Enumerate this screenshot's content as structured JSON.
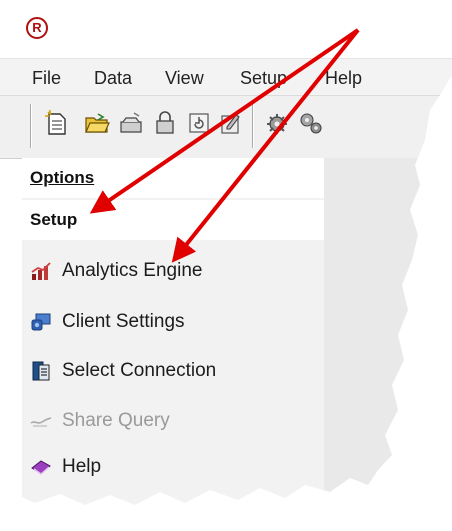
{
  "app": {
    "logo_text": "R"
  },
  "menubar": {
    "items": [
      {
        "label": "File"
      },
      {
        "label": "Data"
      },
      {
        "label": "View"
      },
      {
        "label": "Setup"
      },
      {
        "label": "Help"
      }
    ]
  },
  "toolbar": {
    "buttons": [
      {
        "icon": "new-document-icon"
      },
      {
        "icon": "open-folder-icon"
      },
      {
        "icon": "open-file-icon"
      },
      {
        "icon": "lock-icon"
      },
      {
        "icon": "refresh-icon"
      },
      {
        "icon": "edit-icon"
      },
      {
        "icon": "gear-icon"
      },
      {
        "icon": "gears-icon"
      }
    ]
  },
  "sidebar": {
    "options_label": "Options",
    "setup_label": "Setup",
    "items": [
      {
        "label": "Analytics Engine",
        "icon": "analytics-chart-icon",
        "enabled": true
      },
      {
        "label": "Client Settings",
        "icon": "client-settings-icon",
        "enabled": true
      },
      {
        "label": "Select Connection",
        "icon": "connection-icon",
        "enabled": true
      },
      {
        "label": "Share Query",
        "icon": "share-query-icon",
        "enabled": false
      },
      {
        "label": "Help",
        "icon": "help-book-icon",
        "enabled": true
      }
    ]
  },
  "annotation": {
    "arrow_color": "#e00000"
  }
}
